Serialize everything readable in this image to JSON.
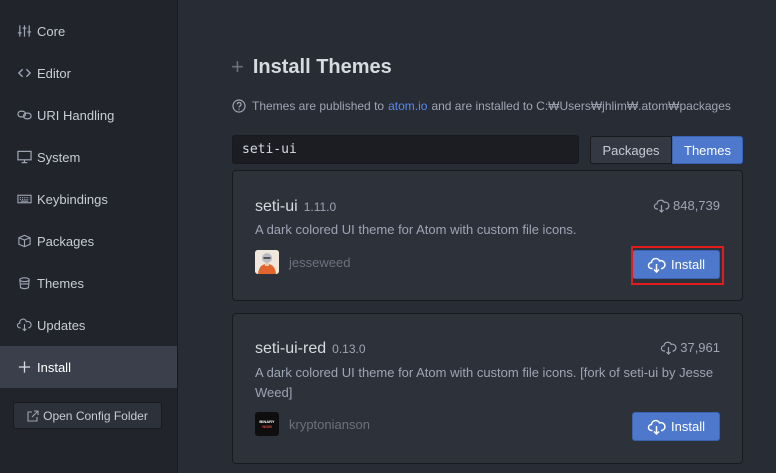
{
  "sidebar": {
    "items": [
      {
        "label": "Core",
        "icon": "settings-sliders-icon"
      },
      {
        "label": "Editor",
        "icon": "code-icon"
      },
      {
        "label": "URI Handling",
        "icon": "link-icon"
      },
      {
        "label": "System",
        "icon": "monitor-icon"
      },
      {
        "label": "Keybindings",
        "icon": "keyboard-icon"
      },
      {
        "label": "Packages",
        "icon": "package-icon"
      },
      {
        "label": "Themes",
        "icon": "paintcan-icon"
      },
      {
        "label": "Updates",
        "icon": "cloud-download-icon"
      },
      {
        "label": "Install",
        "icon": "plus-icon"
      }
    ],
    "active": "Install",
    "open_config_label": "Open Config Folder"
  },
  "main": {
    "title": "Install Themes",
    "info": {
      "prefix": "Themes are published to",
      "link": "atom.io",
      "suffix": "and are installed to C:₩Users₩jhlim₩.atom₩packages"
    },
    "search": {
      "value": "seti-ui"
    },
    "toggle": {
      "packages_label": "Packages",
      "themes_label": "Themes",
      "selected": "Themes"
    },
    "results": [
      {
        "name": "seti-ui",
        "version": "1.11.0",
        "downloads": "848,739",
        "description": "A dark colored UI theme for Atom with custom file icons.",
        "owner": "jesseweed",
        "install_label": "Install"
      },
      {
        "name": "seti-ui-red",
        "version": "0.13.0",
        "downloads": "37,961",
        "description": "A dark colored UI theme for Atom with custom file icons. [fork of seti-ui by Jesse Weed]",
        "owner": "kryptonianson",
        "avatar_text": [
          "BINARY",
          "NOM"
        ],
        "install_label": "Install"
      }
    ]
  },
  "colors": {
    "accent": "#4d78cc",
    "sidebar_bg": "#21252b",
    "main_bg": "#282c34",
    "card_bg": "#2c313a",
    "highlight": "#e21c1c",
    "link": "#568af2"
  }
}
